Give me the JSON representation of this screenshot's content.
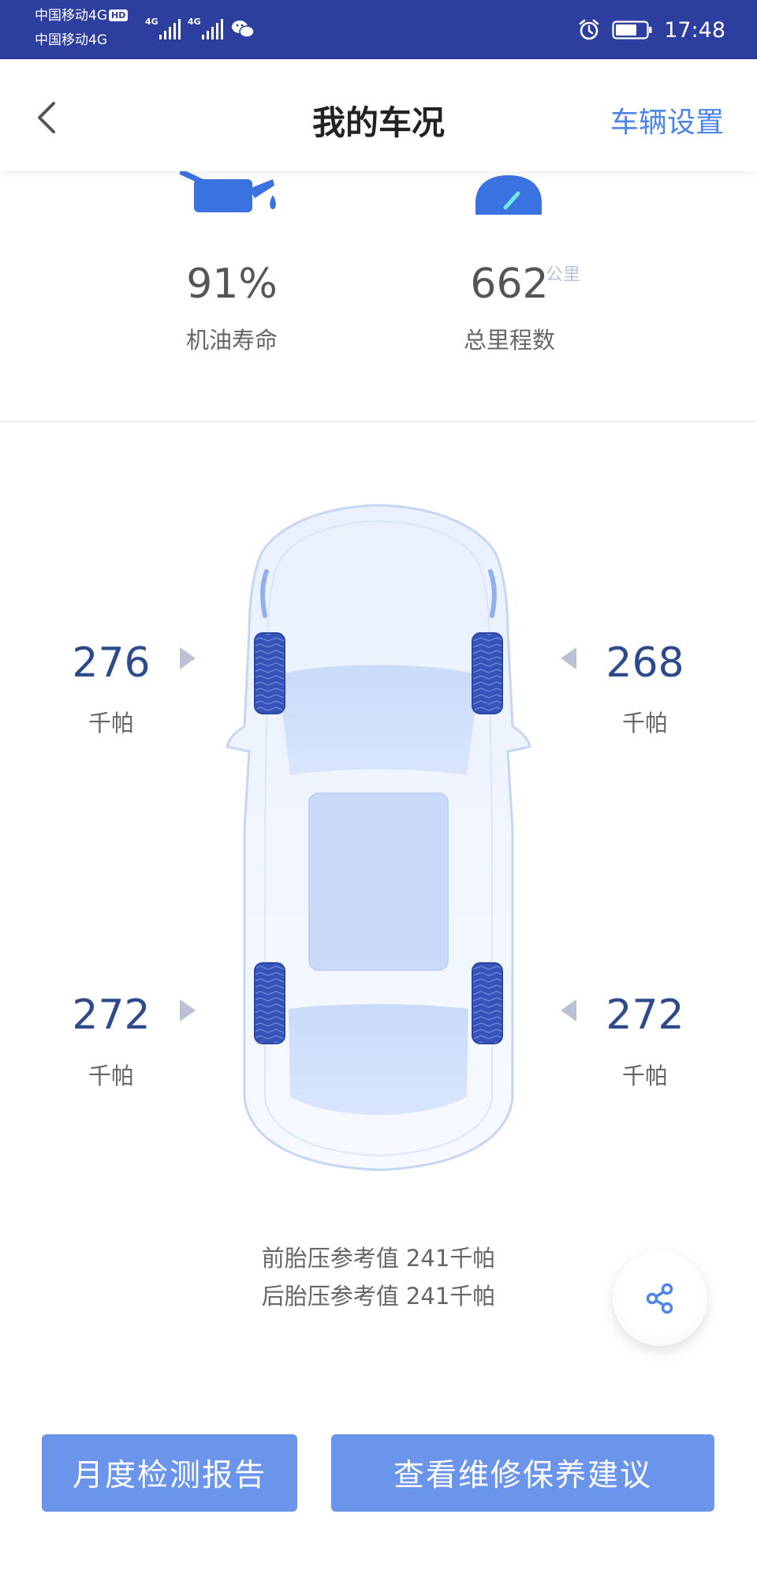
{
  "status_bar": {
    "carrier_1": "中国移动4G",
    "hd_badge": "HD",
    "carrier_2": "中国移动4G",
    "net_1": "4G",
    "net_2": "4G",
    "time": "17:48"
  },
  "nav": {
    "title": "我的车况",
    "action": "车辆设置"
  },
  "stats": [
    {
      "value": "91%",
      "unit": "",
      "label": "机油寿命",
      "icon": "oil-can-icon"
    },
    {
      "value": "662",
      "unit": "公里",
      "label": "总里程数",
      "icon": "odometer-icon"
    }
  ],
  "tires": {
    "front_left": {
      "value": "276",
      "unit": "千帕"
    },
    "front_right": {
      "value": "268",
      "unit": "千帕"
    },
    "rear_left": {
      "value": "272",
      "unit": "千帕"
    },
    "rear_right": {
      "value": "272",
      "unit": "千帕"
    }
  },
  "reference": {
    "front": "前胎压参考值 241千帕",
    "rear": "后胎压参考值 241千帕"
  },
  "buttons": {
    "monthly_report": "月度检测报告",
    "maintenance_advice": "查看维修保养建议"
  },
  "colors": {
    "status_bar": "#2c3e9e",
    "accent": "#4c84e8",
    "button": "#6a95ea",
    "tire_value": "#2d4a8a"
  }
}
